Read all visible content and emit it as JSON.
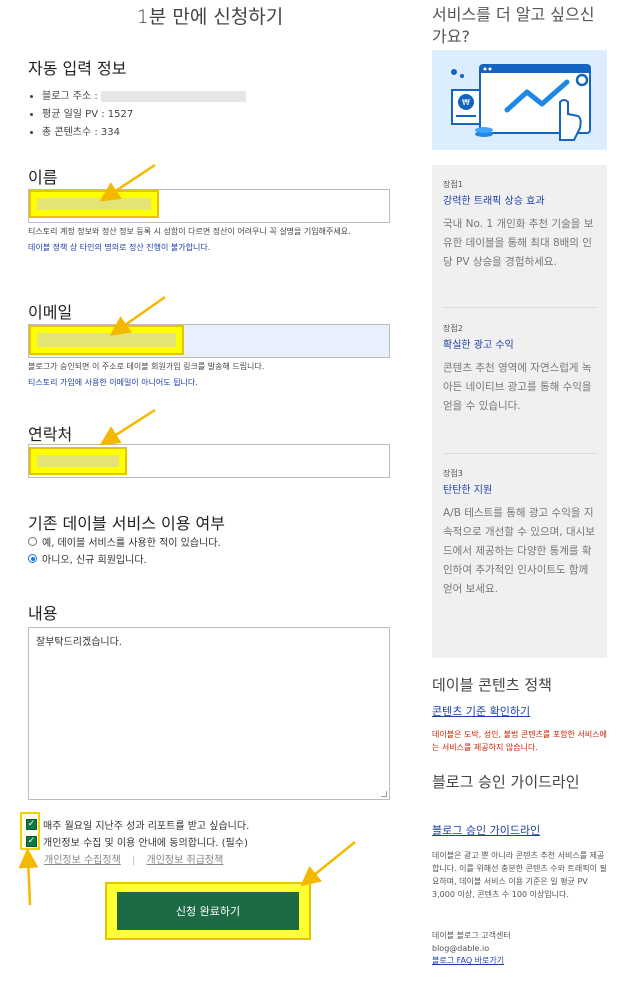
{
  "form": {
    "title": "1분 만에 신청하기",
    "auto_info": {
      "title": "자동 입력 정보",
      "items": [
        {
          "label": "블로그 주소 :",
          "value": ""
        },
        {
          "label": "평균 일일 PV :",
          "value": "1527"
        },
        {
          "label": "총 콘텐츠수 :",
          "value": "334"
        }
      ]
    },
    "name": {
      "label": "이름",
      "value": "",
      "note1": "티스토리 계정 정보와 정산 정보 등록 시 성함이 다르면 정산이 어려우니 꼭 실명을 기입해주세요.",
      "note2": "데이블 정책 상 타인의 명의로 정산 진행이 불가합니다."
    },
    "email": {
      "label": "이메일",
      "value": "",
      "note1": "블로그가 승인되면 이 주소로 데이블 회원가입 링크를 발송해 드립니다.",
      "note2": "티스토리 가입에 사용한 이메일이 아니어도 됩니다."
    },
    "phone": {
      "label": "연락처",
      "value": ""
    },
    "service_usage": {
      "title": "기존 데이블 서비스 이용 여부",
      "options": [
        {
          "label": "예, 데이블 서비스를 사용한 적이 있습니다.",
          "checked": false
        },
        {
          "label": "아니오, 신규 회원입니다.",
          "checked": true
        }
      ]
    },
    "content": {
      "label": "내용",
      "value": "잘부탁드리겠습니다."
    },
    "consents": [
      {
        "label": "매주 월요일 지난주 성과 리포트를 받고 싶습니다.",
        "checked": true
      },
      {
        "label": "개인정보 수집 및 이용 안내에 동의합니다. (필수)",
        "checked": true
      }
    ],
    "policy_links": [
      "개인정보 수집정책",
      "개인정보 취급정책"
    ],
    "policy_sep": "|",
    "submit_label": "신청 완료하기"
  },
  "sidebar": {
    "title": "서비스를 더 알고 싶으신가요?",
    "benefits": [
      {
        "tag": "장점1",
        "title": "강력한 트래픽 상승 효과",
        "desc": "국내 No. 1 개인화 추천 기술을 보유한 데이블을 통해 최대 8배의 인당 PV 상승을 경험하세요."
      },
      {
        "tag": "장점2",
        "title": "확실한 광고 수익",
        "desc": "콘텐츠 추천 영역에 자연스럽게 녹아든 네이티브 광고를 통해 수익을 얻을 수 있습니다."
      },
      {
        "tag": "장점3",
        "title": "탄탄한 지원",
        "desc": "A/B 테스트를 통해 광고 수익을 지속적으로 개선할 수 있으며, 대시보드에서 제공하는 다양한 통계를 확인하여 추가적인 인사이트도 함께 얻어 보세요."
      }
    ],
    "policy": {
      "title": "데이블 콘텐츠 정책",
      "link": "콘텐츠 기준 확인하기",
      "warning": "데이블은 도박, 성인, 불법 콘텐츠를 포함한 서비스에는 서비스를 제공하지 않습니다."
    },
    "guide": {
      "title": "블로그 승인 가이드라인",
      "link": "블로그 승인 가이드라인",
      "desc": "데이블은 광고 뿐 아니라 콘텐츠 추천 서비스를 제공합니다. 이를 위해선 충분한 콘텐츠 수와 트래픽이 필요하며, 데이블 서비스 이용 기준은 일 평균 PV 3,000 이상, 콘텐츠 수 100 이상입니다.",
      "contact_label": "데이블 블로그 고객센터",
      "contact_email": "blog@dable.io",
      "faq_link": "블로그 FAQ 바로가기"
    }
  },
  "colors": {
    "submit_bg": "#1d6b45",
    "highlight": "#ffff00",
    "link": "#1a3fa6",
    "warning": "#cc2200",
    "arrow": "#f5b800"
  }
}
